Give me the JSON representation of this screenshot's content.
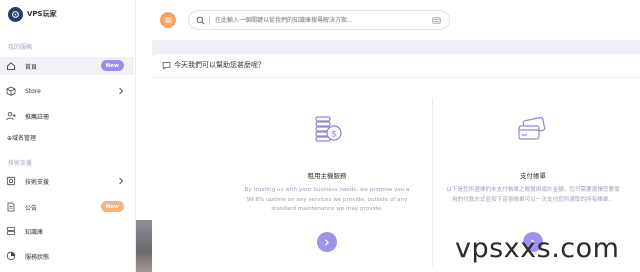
{
  "brand": {
    "name": "VPS玩家"
  },
  "sidebar": {
    "section_my_services": "我的服務",
    "section_tech_support": "技術支援",
    "items": [
      {
        "label": "首頁",
        "badge": "New",
        "icon": "home-icon"
      },
      {
        "label": "Store",
        "icon": "box-icon"
      },
      {
        "label": "推薦註冊",
        "icon": "user-plus-icon"
      },
      {
        "label": "⊕域名管理",
        "icon": "globe-icon"
      },
      {
        "label": "技術支援",
        "icon": "support-icon"
      },
      {
        "label": "公告",
        "badge": "New",
        "icon": "news-icon"
      },
      {
        "label": "知識庫",
        "icon": "database-icon"
      },
      {
        "label": "服務狀態",
        "icon": "status-icon"
      }
    ]
  },
  "search": {
    "placeholder": "在此輸入一個關鍵以從我們的知識庫搜尋解決方案..."
  },
  "main": {
    "card_title": "今天我們可以幫助您甚麼呢？",
    "features": [
      {
        "title": "租用主機服務",
        "description": "By trusting us with your business needs, we promise you a 99.6% uptime on any services we provide, outside of any standard maintenance we may provide.",
        "icon": "coins-icon"
      },
      {
        "title": "支付帳單",
        "description": "以下是您所選擇的未支付帳單之概覽與總計金額，您只需要選擇您要使用的付款方式並按下這張帳單可以一次支付您所選取的所有帳單。",
        "icon": "credit-cards-icon"
      }
    ]
  },
  "watermark": "vpsxxs.com",
  "colors": {
    "accent": "#9d93ea",
    "orange": "#f6a464",
    "new_badge": "#9a8fe6",
    "new_badge_orange": "#f6b27a"
  }
}
